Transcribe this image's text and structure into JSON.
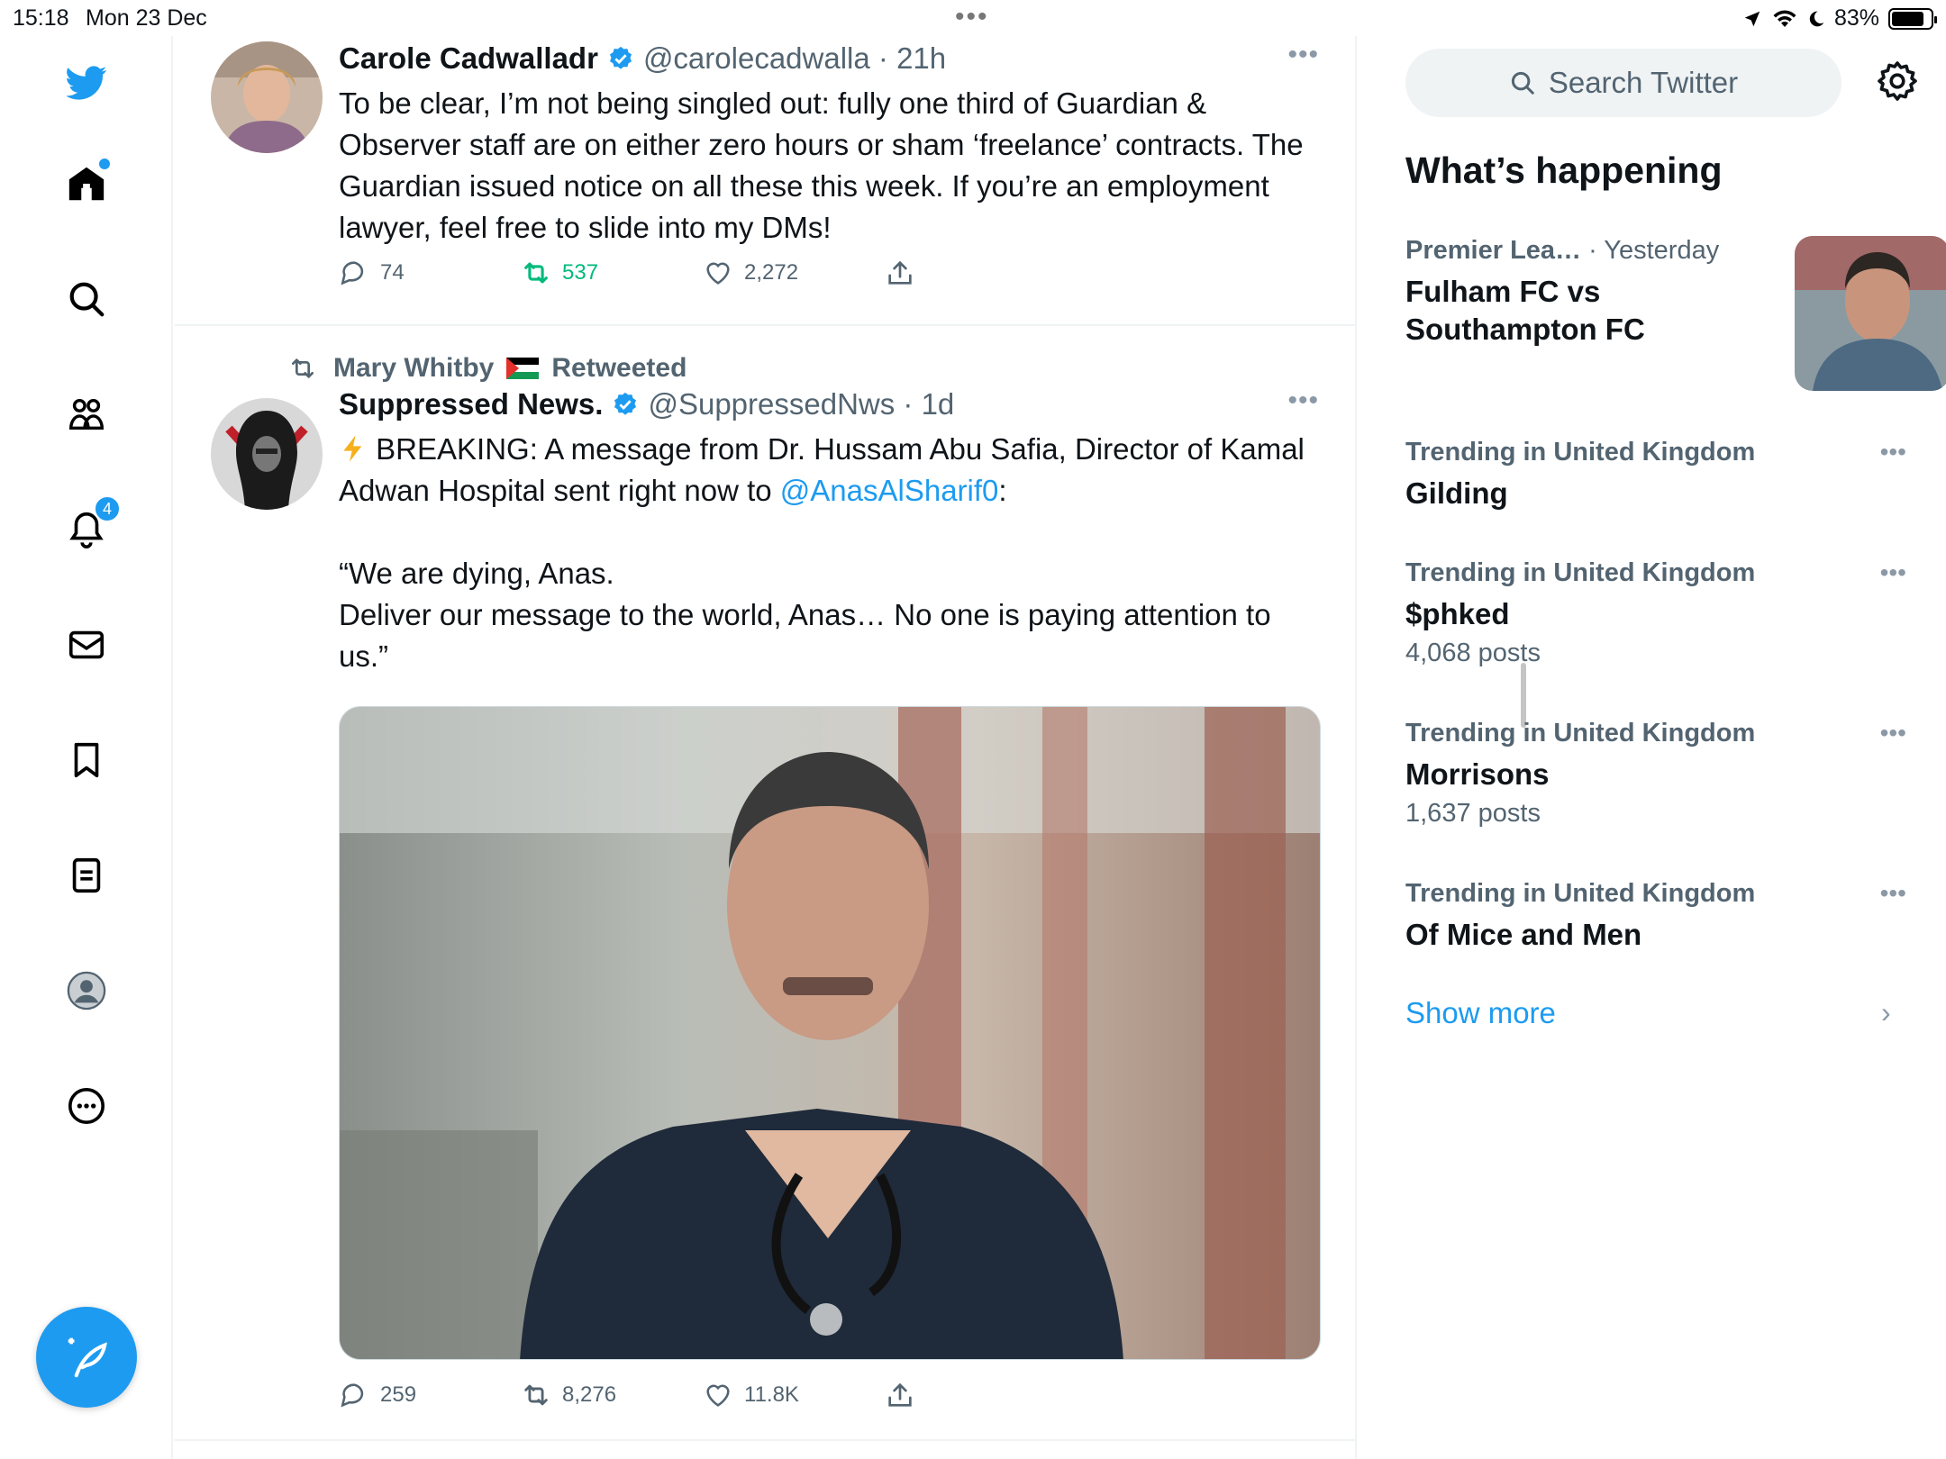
{
  "status_bar": {
    "time": "15:18",
    "date": "Mon 23 Dec",
    "battery": "83%",
    "battery_level": 0.83
  },
  "nav": {
    "notifications_badge": "4",
    "items": [
      "twitter-logo",
      "home",
      "explore",
      "communities",
      "notifications",
      "messages",
      "bookmarks",
      "lists",
      "profile",
      "more"
    ]
  },
  "tweets": [
    {
      "name": "Carole Cadwalladr",
      "handle": "@carolecadwalla",
      "time": "21h",
      "text": "To be clear, I’m not being singled out: fully one third of Guardian & Observer staff are on either zero hours or sham ‘freelance’ contracts. The Guardian issued notice on all these this week. If you’re an employment lawyer, feel free to slide into my DMs!",
      "replies": "74",
      "retweets": "537",
      "likes": "2,272"
    },
    {
      "retweeted_by": "Mary Whitby",
      "retweeted_label": "Retweeted",
      "name": "Suppressed News.",
      "handle": "@SuppressedNws",
      "time": "1d",
      "text_pre": "BREAKING: A message from Dr. Hussam Abu Safia, Director of Kamal Adwan Hospital sent right now to ",
      "mention": "@AnasAlSharif0",
      "text_post": ":",
      "quote_line1": "“We are dying, Anas.",
      "quote_line2": "Deliver our message to the world, Anas… No one is paying attention to us.”",
      "replies": "259",
      "retweets": "8,276",
      "likes": "11.8K"
    }
  ],
  "right": {
    "search_placeholder": "Search Twitter",
    "section_title": "What’s happening",
    "trends": [
      {
        "context": "Premier Lea…",
        "time": "· Yesterday",
        "title": "Fulham FC vs Southampton FC",
        "posts": ""
      },
      {
        "context": "Trending in United Kingdom",
        "title": "Gilding",
        "posts": ""
      },
      {
        "context": "Trending in United Kingdom",
        "title": "$phked",
        "posts": "4,068 posts"
      },
      {
        "context": "Trending in United Kingdom",
        "title": "Morrisons",
        "posts": "1,637 posts"
      },
      {
        "context": "Trending in United Kingdom",
        "title": "Of Mice and Men",
        "posts": ""
      }
    ],
    "show_more": "Show more"
  },
  "colors": {
    "accent": "#1d9bf0",
    "retweet_green": "#00ba7c",
    "text_secondary": "#536471"
  }
}
